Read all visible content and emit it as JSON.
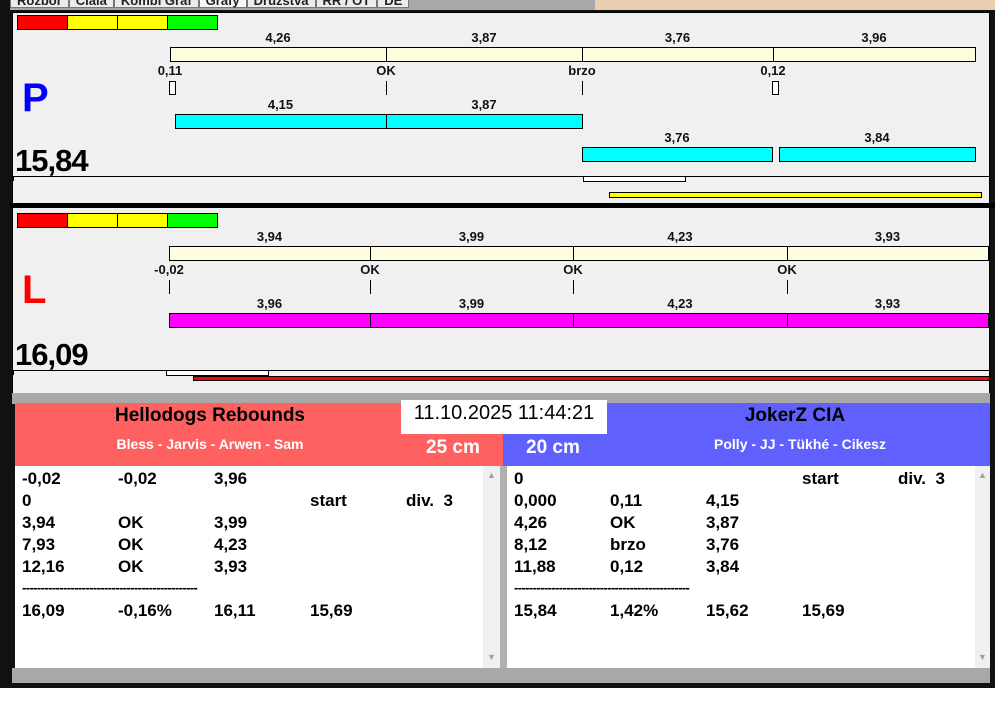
{
  "tabs": [
    "Rozbor",
    "Ciala",
    "Kombi Graf",
    "Grafy",
    "Družstva",
    "RR / OT",
    "DE"
  ],
  "colors": {
    "red": "#ff0000",
    "yellow": "#ffff00",
    "green": "#00ff00",
    "cream": "#fffde0",
    "cyan": "#00ffff",
    "magenta": "#ff00ff",
    "left_team": "#ff6060",
    "right_team": "#6060ff",
    "p_letter": "#0000ff",
    "l_letter": "#ff0000"
  },
  "panel_p": {
    "letter": "P",
    "total": "15,84",
    "lane": {
      "times": [
        "4,26",
        "3,87",
        "3,76",
        "3,96"
      ],
      "marks": [
        "0,11",
        "OK",
        "brzo",
        "0,12"
      ]
    },
    "dog_row1": [
      "4,15",
      "3,87"
    ],
    "dog_row2": [
      "3,76",
      "3,84"
    ]
  },
  "panel_l": {
    "letter": "L",
    "total": "16,09",
    "lane": {
      "times": [
        "3,94",
        "3,99",
        "4,23",
        "3,93"
      ],
      "marks": [
        "-0,02",
        "OK",
        "OK",
        "OK"
      ]
    },
    "dog_row1": [
      "3,96",
      "3,99",
      "4,23",
      "3,93"
    ]
  },
  "timestamp": "11.10.2025 11:44:21",
  "left_team": {
    "name": "Hellodogs Rebounds",
    "dogs": "Bless - Jarvis - Arwen - Sam",
    "jump": "25 cm",
    "rows": [
      [
        "-0,02",
        "-0,02",
        "3,96",
        "",
        ""
      ],
      [
        "0",
        "",
        "",
        "start",
        "div.  3"
      ],
      [
        "3,94",
        "OK",
        "3,99",
        "",
        ""
      ],
      [
        "7,93",
        "OK",
        "4,23",
        "",
        ""
      ],
      [
        "12,16",
        "OK",
        "3,93",
        "",
        ""
      ],
      [
        "-----------------------------------------------",
        "",
        "",
        "",
        ""
      ],
      [
        "16,09",
        "-0,16%",
        "16,11",
        "15,69",
        ""
      ]
    ]
  },
  "right_team": {
    "name": "JokerZ CIA",
    "dogs": "Polly - JJ - Tükhé - Cikesz",
    "jump": "20 cm",
    "rows": [
      [
        "0",
        "",
        "",
        "start",
        "div.  3"
      ],
      [
        "0,000",
        "0,11",
        "4,15",
        "",
        ""
      ],
      [
        "4,26",
        "OK",
        "3,87",
        "",
        ""
      ],
      [
        "8,12",
        "brzo",
        "3,76",
        "",
        ""
      ],
      [
        "11,88",
        "0,12",
        "3,84",
        "",
        ""
      ],
      [
        "-----------------------------------------------",
        "",
        "",
        "",
        ""
      ],
      [
        "15,84",
        "1,42%",
        "15,62",
        "15,69",
        ""
      ]
    ]
  }
}
